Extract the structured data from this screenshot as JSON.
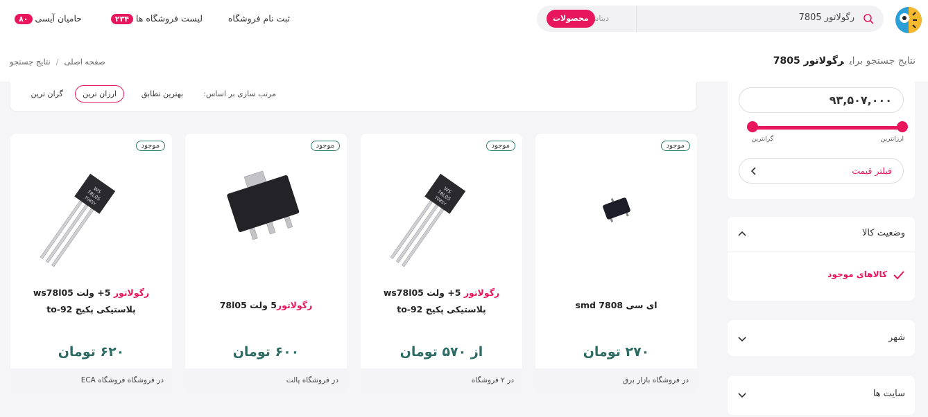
{
  "header": {
    "search_query": "رگولاتور 7805",
    "tab_datasheet": "دیتاشیت",
    "tab_products": "محصولات",
    "nav_register": "ثبت نام فروشگاه",
    "nav_stores": "لیست فروشگاه ها",
    "nav_stores_count": "۲۳۴",
    "nav_sponsors": "حامیان آیسی",
    "nav_sponsors_count": "۸۰"
  },
  "results": {
    "prefix": "نتایج جستجو برای",
    "query": "رگولاتور 7805"
  },
  "breadcrumb": {
    "home": "صفحه اصلی",
    "separator": "/",
    "current": "نتایج جستجو"
  },
  "sort": {
    "label": "مرتب سازی بر اساس:",
    "best": "بهترین تطابق",
    "cheapest": "ارزان ترین",
    "most_expensive": "گران ترین"
  },
  "price_filter": {
    "max_value": "۹۳,۵۰۷,۰۰۰",
    "label_cheapest": "ارزانترین",
    "label_expensive": "گرانترین",
    "button": "فیلتر قیمت"
  },
  "filters": {
    "status_title": "وضعیت کالا",
    "status_option": "کالاهای موجود",
    "city_title": "شهر",
    "sites_title": "سایت ها"
  },
  "products": [
    {
      "stock": "موجود",
      "title_plain": "ای سی 7808 smd",
      "price": "۲۷۰ تومان",
      "store": "در فروشگاه بازار برق"
    },
    {
      "stock": "موجود",
      "title_hl": "رگولاتور",
      "title_rest": " 5+ ولت ws78l05 پلاستیکی پکیج to-92",
      "price": "از ۵۷۰ تومان",
      "store": "در ۲ فروشگاه"
    },
    {
      "stock": "موجود",
      "title_hl": "رگولاتور",
      "title_rest": "5 ولت 78l05",
      "price": "۶۰۰ تومان",
      "store": "در فروشگاه پالت"
    },
    {
      "stock": "موجود",
      "title_hl": "رگولاتور",
      "title_rest": " 5+ ولت ws78l05 پلاستیکی پکیج to-92",
      "price": "۶۲۰ تومان",
      "store": "در فروشگاه فروشگاه ECA"
    }
  ],
  "colors": {
    "accent": "#e8175d",
    "price": "#2b6b63"
  }
}
